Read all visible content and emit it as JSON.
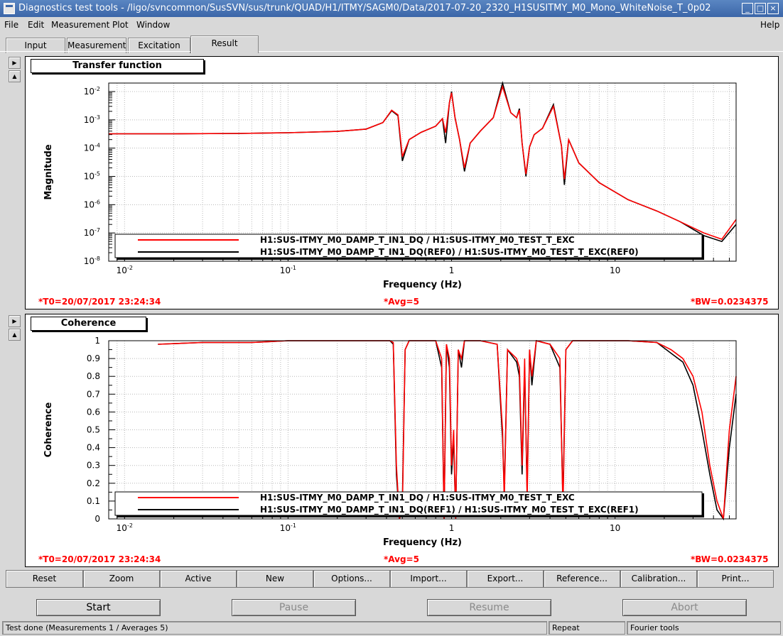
{
  "window": {
    "title": "Diagnostics test tools - /ligo/svncommon/SusSVN/sus/trunk/QUAD/H1/ITMY/SAGM0/Data/2017-07-20_2320_H1SUSITMY_M0_Mono_WhiteNoise_T_0p02",
    "help": "Help"
  },
  "menu": [
    "File",
    "Edit",
    "Measurement",
    "Plot",
    "Window"
  ],
  "tabs": [
    {
      "label": "Input",
      "active": false
    },
    {
      "label": "Measurement",
      "active": false
    },
    {
      "label": "Excitation",
      "active": false
    },
    {
      "label": "Result",
      "active": true
    }
  ],
  "panels": [
    {
      "title": "Transfer function",
      "t0": "*T0=20/07/2017 23:24:34",
      "avg": "*Avg=5",
      "bw": "*BW=0.0234375"
    },
    {
      "title": "Coherence",
      "t0": "*T0=20/07/2017 23:24:34",
      "avg": "*Avg=5",
      "bw": "*BW=0.0234375"
    }
  ],
  "chart_data": [
    {
      "type": "line",
      "title": "Transfer function",
      "xlabel": "Frequency (Hz)",
      "ylabel": "Magnitude",
      "xscale": "log",
      "yscale": "log",
      "xlim": [
        0.008,
        55
      ],
      "ylim": [
        1e-08,
        0.02
      ],
      "grid": true,
      "x_ticks": [
        "10-2",
        "10-1",
        "1",
        "10"
      ],
      "y_ticks": [
        "10-8",
        "10-7",
        "10-6",
        "10-5",
        "10-4",
        "10-3",
        "10-2"
      ],
      "legend_placement": "bottom",
      "series": [
        {
          "name": "H1:SUS-ITMY_M0_DAMP_T_IN1_DQ / H1:SUS-ITMY_M0_TEST_T_EXC",
          "color": "#ff0000",
          "x": [
            0.008,
            0.02,
            0.05,
            0.1,
            0.2,
            0.3,
            0.38,
            0.43,
            0.47,
            0.5,
            0.55,
            0.65,
            0.8,
            0.88,
            0.92,
            0.97,
            1.0,
            1.05,
            1.12,
            1.2,
            1.3,
            1.5,
            1.8,
            2.05,
            2.3,
            2.5,
            2.6,
            2.7,
            2.85,
            3.0,
            3.2,
            3.6,
            4.2,
            4.7,
            4.9,
            5.2,
            6.0,
            8.0,
            12.0,
            18.0,
            25.0,
            35.0,
            45.0,
            55.0
          ],
          "y": [
            0.00032,
            0.00032,
            0.00033,
            0.00035,
            0.00039,
            0.00047,
            0.0008,
            0.0022,
            0.0015,
            5e-05,
            0.0002,
            0.00036,
            0.0006,
            0.0011,
            0.00035,
            0.004,
            0.009,
            0.0012,
            0.0002,
            2e-05,
            0.00015,
            0.0004,
            0.0012,
            0.015,
            0.0018,
            0.0012,
            0.0022,
            0.00015,
            1.2e-05,
            0.00011,
            0.0003,
            0.0005,
            0.003,
            0.00012,
            8e-06,
            0.0002,
            3e-05,
            6e-06,
            1.5e-06,
            6e-07,
            2.5e-07,
            1e-07,
            6e-08,
            3e-07
          ]
        },
        {
          "name": "H1:SUS-ITMY_M0_DAMP_T_IN1_DQ(REF0) / H1:SUS-ITMY_M0_TEST_T_EXC(REF0)",
          "color": "#000000",
          "x": [
            0.008,
            0.02,
            0.05,
            0.1,
            0.2,
            0.3,
            0.38,
            0.43,
            0.47,
            0.5,
            0.55,
            0.65,
            0.8,
            0.88,
            0.92,
            0.97,
            1.0,
            1.05,
            1.12,
            1.2,
            1.3,
            1.5,
            1.8,
            2.05,
            2.3,
            2.5,
            2.6,
            2.7,
            2.85,
            3.0,
            3.2,
            3.6,
            4.2,
            4.7,
            4.9,
            5.2,
            6.0,
            8.0,
            12.0,
            18.0,
            25.0,
            35.0,
            45.0,
            55.0
          ],
          "y": [
            0.00032,
            0.00032,
            0.00033,
            0.00035,
            0.00039,
            0.00047,
            0.0008,
            0.0021,
            0.0014,
            3.5e-05,
            0.0002,
            0.00036,
            0.0006,
            0.0011,
            0.00015,
            0.004,
            0.01,
            0.0012,
            0.0002,
            1.5e-05,
            0.00015,
            0.0004,
            0.0012,
            0.02,
            0.0018,
            0.0012,
            0.0025,
            0.00015,
            1e-05,
            0.00011,
            0.0003,
            0.0005,
            0.0035,
            0.00012,
            5e-06,
            0.0002,
            3e-05,
            6e-06,
            1.5e-06,
            6e-07,
            2.5e-07,
            8e-08,
            5e-08,
            2e-07
          ]
        }
      ]
    },
    {
      "type": "line",
      "title": "Coherence",
      "xlabel": "Frequency (Hz)",
      "ylabel": "Coherence",
      "xscale": "log",
      "yscale": "linear",
      "xlim": [
        0.008,
        55
      ],
      "ylim": [
        0,
        1
      ],
      "grid": true,
      "x_ticks": [
        "10-2",
        "10-1",
        "1",
        "10"
      ],
      "y_ticks": [
        "0",
        "0.1",
        "0.2",
        "0.3",
        "0.4",
        "0.5",
        "0.6",
        "0.7",
        "0.8",
        "0.9",
        "1"
      ],
      "legend_placement": "bottom",
      "series": [
        {
          "name": "H1:SUS-ITMY_M0_DAMP_T_IN1_DQ / H1:SUS-ITMY_M0_TEST_T_EXC",
          "color": "#ff0000",
          "x": [
            0.016,
            0.03,
            0.06,
            0.1,
            0.2,
            0.35,
            0.42,
            0.44,
            0.46,
            0.48,
            0.5,
            0.52,
            0.55,
            0.6,
            0.8,
            0.87,
            0.9,
            0.93,
            0.97,
            1.0,
            1.03,
            1.06,
            1.1,
            1.15,
            1.2,
            1.5,
            1.9,
            2.05,
            2.1,
            2.2,
            2.5,
            2.6,
            2.7,
            2.8,
            2.9,
            3.0,
            3.1,
            3.3,
            4.0,
            4.6,
            4.8,
            5.0,
            5.5,
            7.0,
            12.0,
            18.0,
            22.0,
            26.0,
            30.0,
            34.0,
            38.0,
            42.0,
            46.0,
            50.0,
            55.0
          ],
          "y": [
            0.98,
            0.99,
            0.99,
            1.0,
            1.0,
            1.0,
            1.0,
            0.99,
            0.3,
            0.0,
            0.05,
            0.95,
            1.0,
            1.0,
            1.0,
            0.9,
            0.0,
            0.98,
            0.9,
            0.3,
            0.5,
            0.0,
            0.95,
            0.9,
            1.0,
            1.0,
            0.98,
            0.5,
            0.1,
            0.95,
            0.9,
            0.85,
            0.3,
            0.9,
            0.1,
            0.95,
            0.8,
            1.0,
            0.98,
            0.9,
            0.05,
            0.95,
            1.0,
            1.0,
            1.0,
            0.99,
            0.95,
            0.9,
            0.8,
            0.6,
            0.3,
            0.1,
            0.0,
            0.5,
            0.8
          ]
        },
        {
          "name": "H1:SUS-ITMY_M0_DAMP_T_IN1_DQ(REF1) / H1:SUS-ITMY_M0_TEST_T_EXC(REF1)",
          "color": "#000000",
          "x": [
            0.016,
            0.03,
            0.06,
            0.1,
            0.2,
            0.35,
            0.42,
            0.44,
            0.46,
            0.48,
            0.5,
            0.52,
            0.55,
            0.6,
            0.8,
            0.87,
            0.9,
            0.93,
            0.97,
            1.0,
            1.03,
            1.06,
            1.1,
            1.15,
            1.2,
            1.5,
            1.9,
            2.05,
            2.1,
            2.2,
            2.5,
            2.6,
            2.7,
            2.8,
            2.9,
            3.0,
            3.1,
            3.3,
            4.0,
            4.6,
            4.8,
            5.0,
            5.5,
            7.0,
            12.0,
            18.0,
            22.0,
            26.0,
            30.0,
            34.0,
            38.0,
            42.0,
            46.0,
            50.0,
            55.0
          ],
          "y": [
            0.98,
            0.99,
            0.99,
            1.0,
            1.0,
            1.0,
            1.0,
            0.98,
            0.25,
            0.0,
            0.1,
            0.95,
            1.0,
            1.0,
            1.0,
            0.85,
            0.0,
            0.98,
            0.85,
            0.25,
            0.45,
            0.0,
            0.95,
            0.85,
            1.0,
            1.0,
            0.98,
            0.45,
            0.15,
            0.95,
            0.88,
            0.8,
            0.25,
            0.85,
            0.15,
            0.95,
            0.75,
            1.0,
            0.98,
            0.85,
            0.1,
            0.95,
            1.0,
            1.0,
            1.0,
            0.99,
            0.93,
            0.88,
            0.75,
            0.5,
            0.25,
            0.05,
            0.0,
            0.4,
            0.7
          ]
        }
      ]
    }
  ],
  "buttons": [
    "Reset",
    "Zoom",
    "Active",
    "New",
    "Options...",
    "Import...",
    "Export...",
    "Reference...",
    "Calibration...",
    "Print..."
  ],
  "controls": [
    {
      "label": "Start",
      "enabled": true
    },
    {
      "label": "Pause",
      "enabled": false
    },
    {
      "label": "Resume",
      "enabled": false
    },
    {
      "label": "Abort",
      "enabled": false
    }
  ],
  "status": {
    "message": "Test done (Measurements 1 / Averages 5)",
    "mode": "Repeat",
    "tool": "Fourier tools"
  }
}
